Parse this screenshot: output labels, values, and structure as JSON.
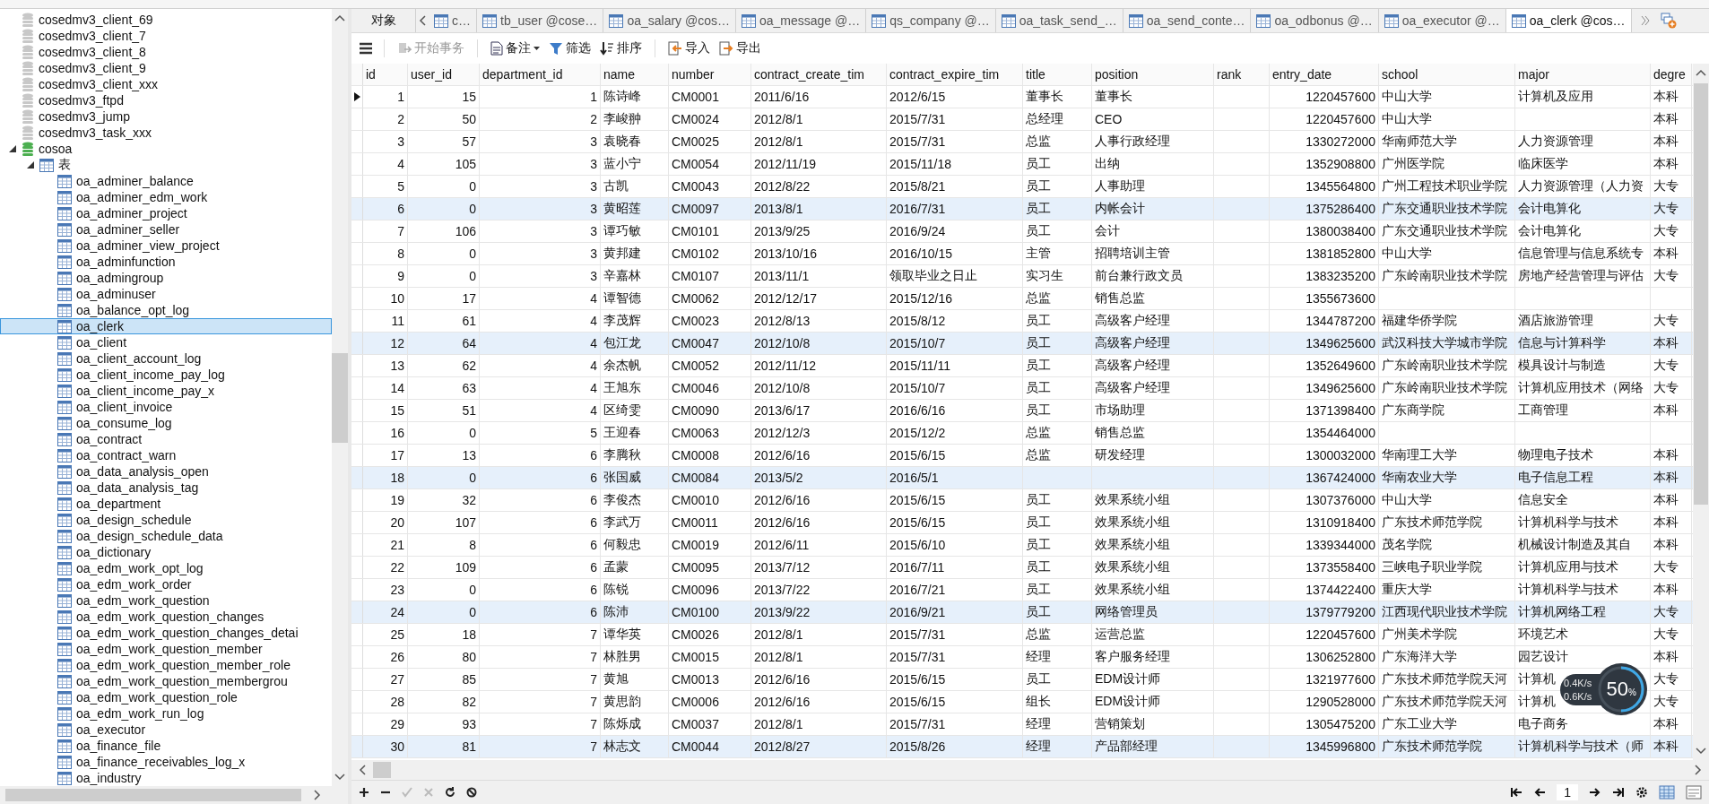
{
  "sidebar": {
    "tree": [
      {
        "label": "cosedmv3_client_69",
        "kind": "database",
        "expanded": false,
        "selected": false
      },
      {
        "label": "cosedmv3_client_7",
        "kind": "database",
        "expanded": false,
        "selected": false
      },
      {
        "label": "cosedmv3_client_8",
        "kind": "database",
        "expanded": false,
        "selected": false
      },
      {
        "label": "cosedmv3_client_9",
        "kind": "database",
        "expanded": false,
        "selected": false
      },
      {
        "label": "cosedmv3_client_xxx",
        "kind": "database",
        "expanded": false,
        "selected": false
      },
      {
        "label": "cosedmv3_ftpd",
        "kind": "database",
        "expanded": false,
        "selected": false
      },
      {
        "label": "cosedmv3_jump",
        "kind": "database",
        "expanded": false,
        "selected": false
      },
      {
        "label": "cosedmv3_task_xxx",
        "kind": "database",
        "expanded": false,
        "selected": false
      },
      {
        "label": "cosoa",
        "kind": "database",
        "expanded": true,
        "selected": false,
        "children": [
          {
            "label": "表",
            "kind": "folder",
            "expanded": true,
            "selected": false,
            "children": [
              {
                "label": "oa_adminer_balance",
                "kind": "table",
                "selected": false
              },
              {
                "label": "oa_adminer_edm_work",
                "kind": "table",
                "selected": false
              },
              {
                "label": "oa_adminer_project",
                "kind": "table",
                "selected": false
              },
              {
                "label": "oa_adminer_seller",
                "kind": "table",
                "selected": false
              },
              {
                "label": "oa_adminer_view_project",
                "kind": "table",
                "selected": false
              },
              {
                "label": "oa_adminfunction",
                "kind": "table",
                "selected": false
              },
              {
                "label": "oa_admingroup",
                "kind": "table",
                "selected": false
              },
              {
                "label": "oa_adminuser",
                "kind": "table",
                "selected": false
              },
              {
                "label": "oa_balance_opt_log",
                "kind": "table",
                "selected": false
              },
              {
                "label": "oa_clerk",
                "kind": "table",
                "selected": true
              },
              {
                "label": "oa_client",
                "kind": "table",
                "selected": false
              },
              {
                "label": "oa_client_account_log",
                "kind": "table",
                "selected": false
              },
              {
                "label": "oa_client_income_pay_log",
                "kind": "table",
                "selected": false
              },
              {
                "label": "oa_client_income_pay_x",
                "kind": "table",
                "selected": false
              },
              {
                "label": "oa_client_invoice",
                "kind": "table",
                "selected": false
              },
              {
                "label": "oa_consume_log",
                "kind": "table",
                "selected": false
              },
              {
                "label": "oa_contract",
                "kind": "table",
                "selected": false
              },
              {
                "label": "oa_contract_warn",
                "kind": "table",
                "selected": false
              },
              {
                "label": "oa_data_analysis_open",
                "kind": "table",
                "selected": false
              },
              {
                "label": "oa_data_analysis_tag",
                "kind": "table",
                "selected": false
              },
              {
                "label": "oa_department",
                "kind": "table",
                "selected": false
              },
              {
                "label": "oa_design_schedule",
                "kind": "table",
                "selected": false
              },
              {
                "label": "oa_design_schedule_data",
                "kind": "table",
                "selected": false
              },
              {
                "label": "oa_dictionary",
                "kind": "table",
                "selected": false
              },
              {
                "label": "oa_edm_work_opt_log",
                "kind": "table",
                "selected": false
              },
              {
                "label": "oa_edm_work_order",
                "kind": "table",
                "selected": false
              },
              {
                "label": "oa_edm_work_question",
                "kind": "table",
                "selected": false
              },
              {
                "label": "oa_edm_work_question_changes",
                "kind": "table",
                "selected": false
              },
              {
                "label": "oa_edm_work_question_changes_detai",
                "kind": "table",
                "selected": false
              },
              {
                "label": "oa_edm_work_question_member",
                "kind": "table",
                "selected": false
              },
              {
                "label": "oa_edm_work_question_member_role",
                "kind": "table",
                "selected": false
              },
              {
                "label": "oa_edm_work_question_membergrou",
                "kind": "table",
                "selected": false
              },
              {
                "label": "oa_edm_work_question_role",
                "kind": "table",
                "selected": false
              },
              {
                "label": "oa_edm_work_run_log",
                "kind": "table",
                "selected": false
              },
              {
                "label": "oa_executor",
                "kind": "table",
                "selected": false
              },
              {
                "label": "oa_finance_file",
                "kind": "table",
                "selected": false
              },
              {
                "label": "oa_finance_receivables_log_x",
                "kind": "table",
                "selected": false
              },
              {
                "label": "oa_industry",
                "kind": "table",
                "selected": false
              }
            ]
          }
        ]
      }
    ]
  },
  "tabs": [
    {
      "label": "对象",
      "kind": "objects",
      "selected": false
    },
    {
      "label": "c…",
      "kind": "table",
      "selected": false
    },
    {
      "label": "tb_user @cose…",
      "kind": "table",
      "selected": false
    },
    {
      "label": "oa_salary @cos…",
      "kind": "table",
      "selected": false
    },
    {
      "label": "oa_message @…",
      "kind": "table",
      "selected": false
    },
    {
      "label": "qs_company @…",
      "kind": "table",
      "selected": false
    },
    {
      "label": "oa_task_send_…",
      "kind": "table",
      "selected": false
    },
    {
      "label": "oa_send_conte…",
      "kind": "table",
      "selected": false
    },
    {
      "label": "oa_odbonus @…",
      "kind": "table",
      "selected": false
    },
    {
      "label": "oa_executor @…",
      "kind": "table",
      "selected": false
    },
    {
      "label": "oa_clerk @cos…",
      "kind": "table",
      "selected": true
    }
  ],
  "toolbar": [
    {
      "label": "开始事务",
      "kind": "transaction",
      "disabled": true
    },
    {
      "label": "备注",
      "kind": "memo",
      "disabled": false
    },
    {
      "label": "筛选",
      "kind": "filter",
      "disabled": false
    },
    {
      "label": "排序",
      "kind": "sort",
      "disabled": false
    },
    {
      "label": "导入",
      "kind": "import",
      "disabled": false
    },
    {
      "label": "导出",
      "kind": "export",
      "disabled": false
    }
  ],
  "grid": {
    "columns": [
      {
        "label": "id",
        "kind": "number"
      },
      {
        "label": "user_id",
        "kind": "number"
      },
      {
        "label": "department_id",
        "kind": "number"
      },
      {
        "label": "name",
        "kind": "text"
      },
      {
        "label": "number",
        "kind": "text"
      },
      {
        "label": "contract_create_tim",
        "kind": "text"
      },
      {
        "label": "contract_expire_tim",
        "kind": "text"
      },
      {
        "label": "title",
        "kind": "text"
      },
      {
        "label": "position",
        "kind": "text"
      },
      {
        "label": "rank",
        "kind": "text"
      },
      {
        "label": "entry_date",
        "kind": "number"
      },
      {
        "label": "school",
        "kind": "text"
      },
      {
        "label": "major",
        "kind": "text"
      },
      {
        "label": "degre",
        "kind": "text"
      }
    ],
    "rows": [
      {
        "current": true,
        "tinted": false,
        "cells": [
          "1",
          "15",
          "1",
          "陈诗峰",
          "CM0001",
          "2011/6/16",
          "2012/6/15",
          "董事长",
          "董事长",
          null,
          "1220457600",
          "中山大学",
          "计算机及应用",
          "本科"
        ]
      },
      {
        "current": false,
        "tinted": false,
        "cells": [
          "2",
          "50",
          "2",
          "李峻翀",
          "CM0024",
          "2012/8/1",
          "2015/7/31",
          "总经理",
          "CEO",
          null,
          "1220457600",
          "中山大学",
          null,
          "本科"
        ]
      },
      {
        "current": false,
        "tinted": false,
        "cells": [
          "3",
          "57",
          "3",
          "袁晓春",
          "CM0025",
          "2012/8/1",
          "2015/7/31",
          "总监",
          "人事行政经理",
          null,
          "1330272000",
          "华南师范大学",
          "人力资源管理",
          "本科"
        ]
      },
      {
        "current": false,
        "tinted": false,
        "cells": [
          "4",
          "105",
          "3",
          "蓝小宁",
          "CM0054",
          "2012/11/19",
          "2015/11/18",
          "员工",
          "出纳",
          null,
          "1352908800",
          "广州医学院",
          "临床医学",
          "本科"
        ]
      },
      {
        "current": false,
        "tinted": false,
        "cells": [
          "5",
          "0",
          "3",
          "古凯",
          "CM0043",
          "2012/8/22",
          "2015/8/21",
          "员工",
          "人事助理",
          null,
          "1345564800",
          "广州工程技术职业学院",
          "人力资源管理（人力资",
          "大专"
        ]
      },
      {
        "current": false,
        "tinted": true,
        "cells": [
          "6",
          "0",
          "3",
          "黄昭莲",
          "CM0097",
          "2013/8/1",
          "2016/7/31",
          "员工",
          "内帐会计",
          null,
          "1375286400",
          "广东交通职业技术学院",
          "会计电算化",
          "大专"
        ]
      },
      {
        "current": false,
        "tinted": false,
        "cells": [
          "7",
          "106",
          "3",
          "谭巧敏",
          "CM0101",
          "2013/9/25",
          "2016/9/24",
          "员工",
          "会计",
          null,
          "1380038400",
          "广东交通职业技术学院",
          "会计电算化",
          "大专"
        ]
      },
      {
        "current": false,
        "tinted": false,
        "cells": [
          "8",
          "0",
          "3",
          "黄邦建",
          "CM0102",
          "2013/10/16",
          "2016/10/15",
          "主管",
          "招聘培训主管",
          null,
          "1381852800",
          "中山大学",
          "信息管理与信息系统专",
          "本科"
        ]
      },
      {
        "current": false,
        "tinted": false,
        "cells": [
          "9",
          "0",
          "3",
          "辛嘉林",
          "CM0107",
          "2013/11/1",
          "领取毕业之日止",
          "实习生",
          "前台兼行政文员",
          null,
          "1383235200",
          "广东岭南职业技术学院",
          "房地产经营管理与评估",
          "大专"
        ]
      },
      {
        "current": false,
        "tinted": false,
        "cells": [
          "10",
          "17",
          "4",
          "谭智德",
          "CM0062",
          "2012/12/17",
          "2015/12/16",
          "总监",
          "销售总监",
          null,
          "1355673600",
          null,
          null,
          null
        ]
      },
      {
        "current": false,
        "tinted": false,
        "cells": [
          "11",
          "61",
          "4",
          "李茂辉",
          "CM0023",
          "2012/8/13",
          "2015/8/12",
          "员工",
          "高级客户经理",
          null,
          "1344787200",
          "福建华侨学院",
          "酒店旅游管理",
          "大专"
        ]
      },
      {
        "current": false,
        "tinted": true,
        "cells": [
          "12",
          "64",
          "4",
          "包江龙",
          "CM0047",
          "2012/10/8",
          "2015/10/7",
          "员工",
          "高级客户经理",
          null,
          "1349625600",
          "武汉科技大学城市学院",
          "信息与计算科学",
          "本科"
        ]
      },
      {
        "current": false,
        "tinted": false,
        "cells": [
          "13",
          "62",
          "4",
          "余杰帆",
          "CM0052",
          "2012/11/12",
          "2015/11/11",
          "员工",
          "高级客户经理",
          null,
          "1352649600",
          "广东岭南职业技术学院",
          "模具设计与制造",
          "大专"
        ]
      },
      {
        "current": false,
        "tinted": false,
        "cells": [
          "14",
          "63",
          "4",
          "王旭东",
          "CM0046",
          "2012/10/8",
          "2015/10/7",
          "员工",
          "高级客户经理",
          null,
          "1349625600",
          "广东岭南职业技术学院",
          "计算机应用技术（网络",
          "大专"
        ]
      },
      {
        "current": false,
        "tinted": false,
        "cells": [
          "15",
          "51",
          "4",
          "区绮雯",
          "CM0090",
          "2013/6/17",
          "2016/6/16",
          "员工",
          "市场助理",
          null,
          "1371398400",
          "广东商学院",
          "工商管理",
          "本科"
        ]
      },
      {
        "current": false,
        "tinted": false,
        "cells": [
          "16",
          "0",
          "5",
          "王迎春",
          "CM0063",
          "2012/12/3",
          "2015/12/2",
          "总监",
          "销售总监",
          null,
          "1354464000",
          null,
          null,
          null
        ]
      },
      {
        "current": false,
        "tinted": false,
        "cells": [
          "17",
          "13",
          "6",
          "李腾秋",
          "CM0008",
          "2012/6/16",
          "2015/6/15",
          "总监",
          "研发经理",
          null,
          "1300032000",
          "华南理工大学",
          "物理电子技术",
          "本科"
        ]
      },
      {
        "current": false,
        "tinted": true,
        "cells": [
          "18",
          "0",
          "6",
          "张国威",
          "CM0084",
          "2013/5/2",
          "2016/5/1",
          null,
          null,
          null,
          "1367424000",
          "华南农业大学",
          "电子信息工程",
          "本科"
        ]
      },
      {
        "current": false,
        "tinted": false,
        "cells": [
          "19",
          "32",
          "6",
          "李俊杰",
          "CM0010",
          "2012/6/16",
          "2015/6/15",
          "员工",
          "效果系统小组",
          null,
          "1307376000",
          "中山大学",
          "信息安全",
          "本科"
        ]
      },
      {
        "current": false,
        "tinted": false,
        "cells": [
          "20",
          "107",
          "6",
          "李武万",
          "CM0011",
          "2012/6/16",
          "2015/6/15",
          "员工",
          "效果系统小组",
          null,
          "1310918400",
          "广东技术师范学院",
          "计算机科学与技术",
          "本科"
        ]
      },
      {
        "current": false,
        "tinted": false,
        "cells": [
          "21",
          "8",
          "6",
          "何毅忠",
          "CM0019",
          "2012/6/11",
          "2015/6/10",
          "员工",
          "效果系统小组",
          null,
          "1339344000",
          "茂名学院",
          "机械设计制造及其自",
          "本科"
        ]
      },
      {
        "current": false,
        "tinted": false,
        "cells": [
          "22",
          "109",
          "6",
          "孟蒙",
          "CM0095",
          "2013/7/12",
          "2016/7/11",
          "员工",
          "效果系统小组",
          null,
          "1373558400",
          "三峡电子职业学院",
          "计算机应用与技术",
          "大专"
        ]
      },
      {
        "current": false,
        "tinted": false,
        "cells": [
          "23",
          "0",
          "6",
          "陈锐",
          "CM0096",
          "2013/7/22",
          "2016/7/21",
          "员工",
          "效果系统小组",
          null,
          "1374422400",
          "重庆大学",
          "计算机科学与技术",
          "本科"
        ]
      },
      {
        "current": false,
        "tinted": true,
        "cells": [
          "24",
          "0",
          "6",
          "陈沛",
          "CM0100",
          "2013/9/22",
          "2016/9/21",
          "员工",
          "网络管理员",
          null,
          "1379779200",
          "江西现代职业技术学院",
          "计算机网络工程",
          "大专"
        ]
      },
      {
        "current": false,
        "tinted": false,
        "cells": [
          "25",
          "18",
          "7",
          "谭华英",
          "CM0026",
          "2012/8/1",
          "2015/7/31",
          "总监",
          "运营总监",
          null,
          "1220457600",
          "广州美术学院",
          "环境艺术",
          "大专"
        ]
      },
      {
        "current": false,
        "tinted": false,
        "cells": [
          "26",
          "80",
          "7",
          "林胜男",
          "CM0015",
          "2012/8/1",
          "2015/7/31",
          "经理",
          "客户服务经理",
          null,
          "1306252800",
          "广东海洋大学",
          "园艺设计",
          "本科"
        ]
      },
      {
        "current": false,
        "tinted": false,
        "cells": [
          "27",
          "85",
          "7",
          "黄旭",
          "CM0013",
          "2012/6/16",
          "2015/6/15",
          "员工",
          "EDM设计师",
          null,
          "1321977600",
          "广东技术师范学院天河",
          "计算机",
          "大专"
        ]
      },
      {
        "current": false,
        "tinted": false,
        "cells": [
          "28",
          "82",
          "7",
          "黄思韵",
          "CM0006",
          "2012/6/16",
          "2015/6/15",
          "组长",
          "EDM设计师",
          null,
          "1290528000",
          "广东技术师范学院天河",
          "计算机",
          "大专"
        ]
      },
      {
        "current": false,
        "tinted": false,
        "cells": [
          "29",
          "93",
          "7",
          "陈烁成",
          "CM0037",
          "2012/8/1",
          "2015/7/31",
          "经理",
          "营销策划",
          null,
          "1305475200",
          "广东工业大学",
          "电子商务",
          "本科"
        ]
      },
      {
        "current": false,
        "tinted": true,
        "cells": [
          "30",
          "81",
          "7",
          "林志文",
          "CM0044",
          "2012/8/27",
          "2015/8/26",
          "经理",
          "产品部经理",
          null,
          "1345996800",
          "广东技术师范学院",
          "计算机科学与技术（师",
          "本科"
        ]
      }
    ]
  },
  "record_actions": [
    {
      "kind": "add",
      "disabled": false
    },
    {
      "kind": "delete",
      "disabled": false
    },
    {
      "kind": "apply",
      "disabled": true
    },
    {
      "kind": "discard",
      "disabled": true
    },
    {
      "kind": "refresh",
      "disabled": false
    },
    {
      "kind": "stop",
      "disabled": false
    }
  ],
  "pager": {
    "page": "1"
  },
  "speed_widget": {
    "upload": "0.4K/s",
    "download": "0.6K/s",
    "percent": "50",
    "unit": "%",
    "level": 0.5
  }
}
